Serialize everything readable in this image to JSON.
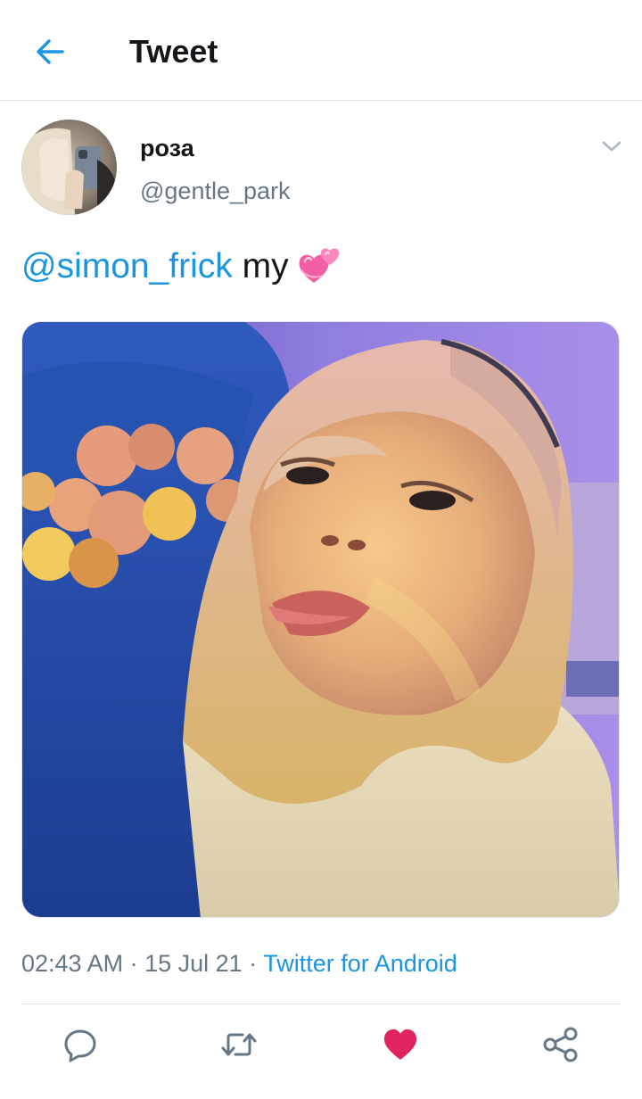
{
  "colors": {
    "accent": "#1b95e0",
    "text_primary": "#14171a",
    "text_secondary": "#657786",
    "like_active": "#e0245e",
    "divider": "#e1e4e8"
  },
  "header": {
    "back_icon": "arrow-left-icon",
    "title": "Tweet"
  },
  "author": {
    "display_name": "роза",
    "handle": "@gentle_park",
    "menu_icon": "chevron-down-icon"
  },
  "tweet": {
    "mention": "@simon_frick",
    "text": " my",
    "emoji": "two-hearts-emoji"
  },
  "media": {
    "icon": "photo"
  },
  "meta": {
    "time": "02:43 AM",
    "separator1": " · ",
    "date": "15 Jul 21",
    "separator2": " · ",
    "source": "Twitter for Android"
  },
  "actions": {
    "reply_icon": "reply-icon",
    "retweet_icon": "retweet-icon",
    "like_icon": "heart-icon",
    "like_state": "liked",
    "share_icon": "share-icon"
  }
}
